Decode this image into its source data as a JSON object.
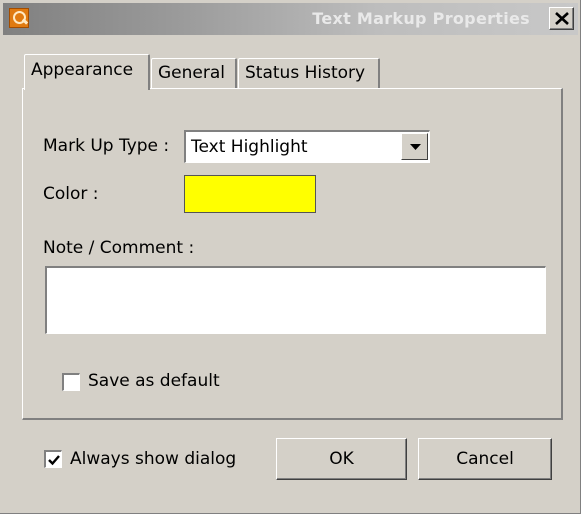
{
  "window": {
    "title": "Text Markup Properties",
    "icon": "app-logo-icon",
    "close_icon": "close-icon"
  },
  "tabs": [
    {
      "label": "Appearance",
      "active": true
    },
    {
      "label": "General",
      "active": false
    },
    {
      "label": "Status History",
      "active": false
    }
  ],
  "appearance": {
    "markup_type_label": "Mark Up Type :",
    "markup_type_value": "Text Highlight",
    "color_label": "Color :",
    "color_value": "#ffff00",
    "note_label": "Note / Comment :",
    "note_value": "",
    "save_default_label": "Save as default",
    "save_default_checked": false
  },
  "footer": {
    "always_show_label": "Always show dialog",
    "always_show_checked": true,
    "ok_label": "OK",
    "cancel_label": "Cancel"
  }
}
